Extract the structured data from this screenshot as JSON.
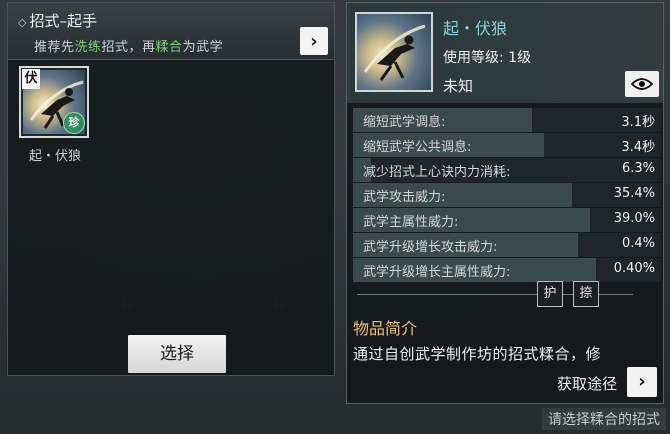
{
  "left_panel": {
    "title": "招式–起手",
    "subtitle_parts": [
      "推荐先",
      "洗练",
      "招式，再",
      "糅合",
      "为武学"
    ],
    "skill": {
      "badge_char": "伏",
      "rarity_char": "珍",
      "name": "起・伏狼"
    },
    "select_label": "选择"
  },
  "detail": {
    "name": "起・伏狼",
    "level_text": "使用等级: 1级",
    "status": "未知",
    "stats": [
      {
        "label": "缩短武学调息:",
        "value": "3.1秒",
        "fill": 0.58
      },
      {
        "label": "缩短武学公共调息:",
        "value": "3.4秒",
        "fill": 0.62
      },
      {
        "label": "减少招式上心诀内力消耗:",
        "value": "6.3%",
        "fill": 0.06
      },
      {
        "label": "武学攻击威力:",
        "value": "35.4%",
        "fill": 0.71
      },
      {
        "label": "武学主属性威力:",
        "value": "39.0%",
        "fill": 0.77
      },
      {
        "label": "武学升级增长攻击威力:",
        "value": "0.4%",
        "fill": 0.73
      },
      {
        "label": "武学升级增长主属性威力:",
        "value": "0.40%",
        "fill": 0.79
      }
    ],
    "tags": [
      "护",
      "捺"
    ],
    "desc_title": "物品简介",
    "desc_text": "通过自创武学制作坊的招式糅合，修",
    "obtain_label": "获取途径"
  },
  "hint": "请选择糅合的招式",
  "colors": {
    "highlight_green": "#7fd07a",
    "name_cyan": "#8ad0dd",
    "desc_gold": "#f2c266"
  }
}
